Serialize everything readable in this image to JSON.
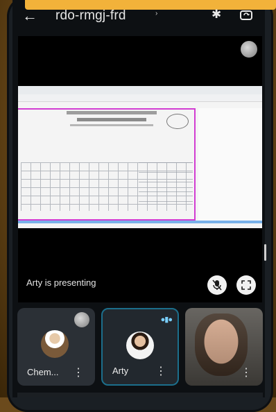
{
  "header": {
    "back_icon": "arrow-left-icon",
    "meeting_code": "rdo-rmgj-frd",
    "chevron": "›",
    "bluetooth_icon": "bluetooth-icon",
    "switch_camera_icon": "switch-camera-icon"
  },
  "stage": {
    "presenting_text": "Arty is presenting",
    "mic_icon": "mic-off-icon",
    "fullscreen_icon": "fullscreen-icon"
  },
  "participants": [
    {
      "name": "Chem...",
      "speaking": false
    },
    {
      "name": "Arty",
      "speaking": true
    },
    {
      "name": "",
      "speaking": false
    }
  ],
  "colors": {
    "accent_tape": "#f2b23a",
    "active_border": "#1c6f8c",
    "slide_highlight": "#d23cd2"
  }
}
